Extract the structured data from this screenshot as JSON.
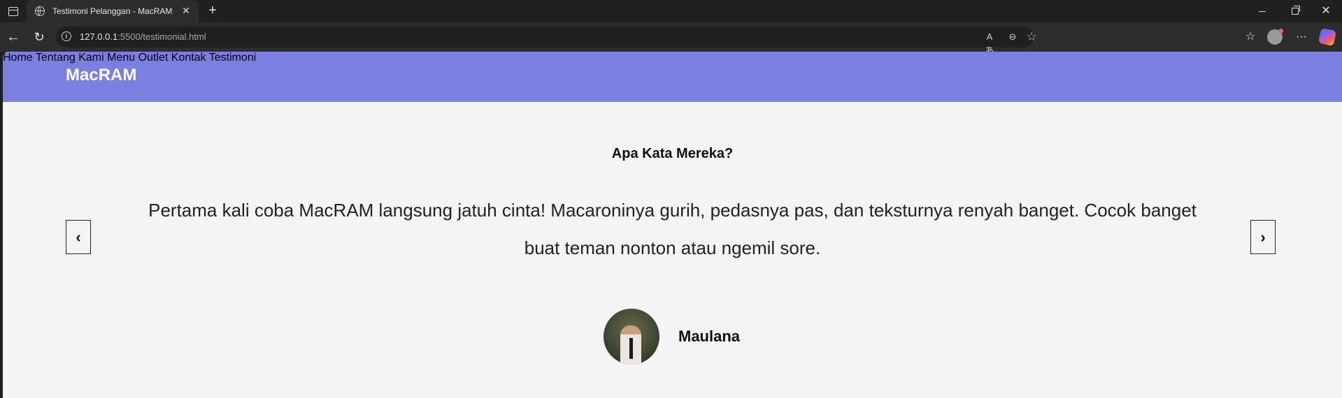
{
  "browser": {
    "tab_title": "Testimoni Pelanggan - MacRAM",
    "url_host": "127.0.0.1",
    "url_rest": ":5500/testimonial.html"
  },
  "site": {
    "brand": "MacRAM",
    "nav": [
      {
        "label": "Home"
      },
      {
        "label": "Tentang Kami"
      },
      {
        "label": "Menu"
      },
      {
        "label": "Outlet"
      },
      {
        "label": "Kontak"
      },
      {
        "label": "Testimoni"
      }
    ]
  },
  "testimonial": {
    "heading": "Apa Kata Mereka?",
    "quote": "Pertama kali coba MacRAM langsung jatuh cinta! Macaroninya gurih, pedasnya pas, dan teksturnya renyah banget. Cocok banget buat teman nonton atau ngemil sore.",
    "name": "Maulana",
    "prev_label": "‹",
    "next_label": "›"
  },
  "colors": {
    "navbar": "#7b80e0",
    "page_bg": "#f4f4f4"
  }
}
